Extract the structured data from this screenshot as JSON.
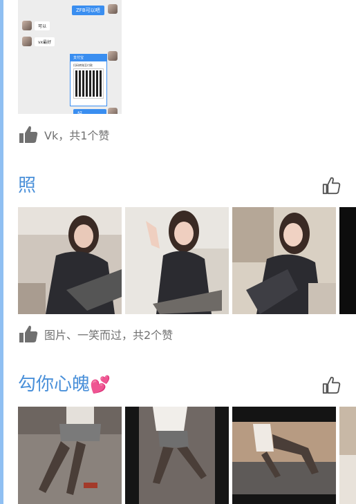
{
  "post1": {
    "chat": {
      "top_bubble": "ZFB可以吧",
      "msg1": "可以",
      "msg2": "vx最好",
      "pay_title": "支付宝",
      "pay_label": "扫码转账至付款",
      "bottom_bubble": "好"
    },
    "likes_text": "Vk，共1个赞"
  },
  "post2": {
    "title": "照",
    "likes_text": "图片、一笑而过，共2个赞"
  },
  "post3": {
    "title": "勾你心魄",
    "emoji": "💕"
  },
  "colors": {
    "accent_blue": "#4a90d9",
    "left_bar": "#8fbff2",
    "like_text": "#707070",
    "chat_blue": "#3a8ef0"
  },
  "icons": {
    "like_filled": "thumbs-up-filled",
    "like_outline": "thumbs-up-outline"
  }
}
